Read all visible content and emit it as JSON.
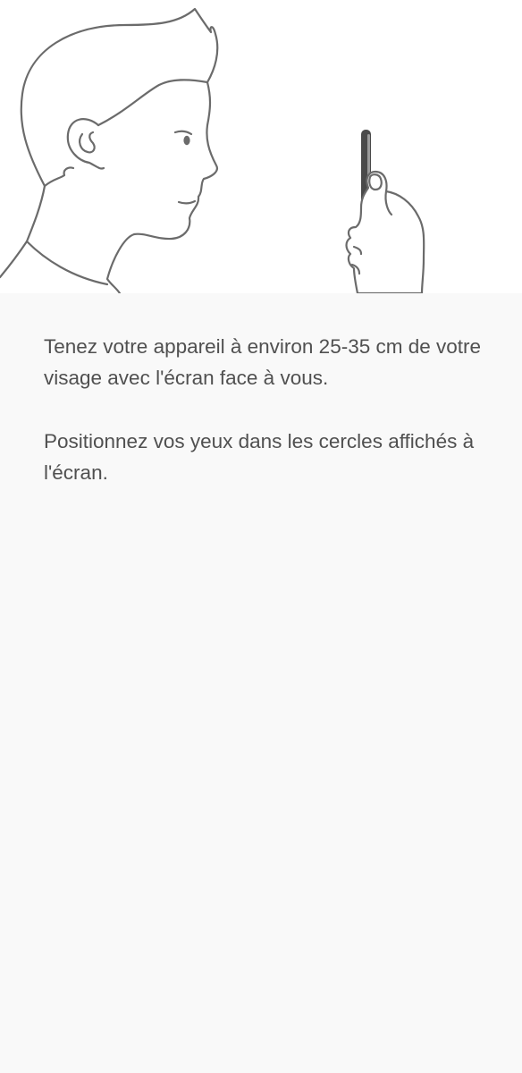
{
  "instructions": {
    "paragraph_1": "Tenez votre appareil à environ 25-35 cm de votre visage avec l'écran face à vous.",
    "paragraph_2": "Positionnez vos yeux dans les cercles affichés à l'écran."
  },
  "illustration": {
    "icon": "face-registration-illustration",
    "line_color": "#6b6b6b",
    "phone_color": "#4a4a4a"
  }
}
